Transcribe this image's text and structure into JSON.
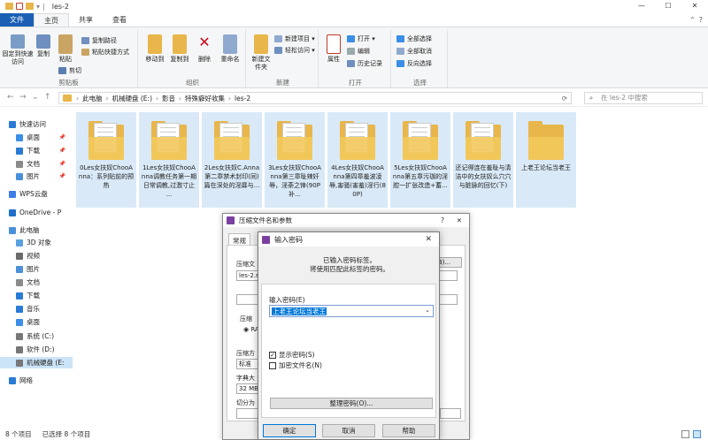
{
  "window": {
    "title": "les-2",
    "controls": [
      "—",
      "☐",
      "✕"
    ]
  },
  "ribbon_tabs": [
    "文件",
    "主页",
    "共享",
    "查看"
  ],
  "ribbon_right": [
    "⌃",
    "?"
  ],
  "ribbon": {
    "clipboard": {
      "pin_label": "固定到快速访问",
      "copy_label": "复制",
      "paste_label": "粘贴",
      "copy_path": "复制路径",
      "paste_shortcut": "粘贴快捷方式",
      "cut": "剪切",
      "group_label": "剪贴板"
    },
    "organize": {
      "move_to": "移动到",
      "copy_to": "复制到",
      "delete": "删除",
      "rename": "重命名",
      "group_label": "组织"
    },
    "new": {
      "new_folder": "新建文件夹",
      "new_item": "新建项目 ▾",
      "easy_access": "轻松访问 ▾",
      "group_label": "新建"
    },
    "open": {
      "properties": "属性",
      "open": "打开 ▾",
      "edit": "编辑",
      "history": "历史记录",
      "group_label": "打开"
    },
    "select": {
      "select_all": "全部选择",
      "select_none": "全部取消",
      "invert": "反向选择",
      "group_label": "选择"
    }
  },
  "address": {
    "path": [
      "此电脑",
      "机械硬盘 (E:)",
      "影音",
      "特殊癖好收集",
      "les-2"
    ],
    "search_placeholder": "在 les-2 中搜索"
  },
  "sidebar": {
    "items": [
      {
        "label": "快速访问",
        "color": "#2a7bd5"
      },
      {
        "label": "桌面",
        "color": "#3a8ee6"
      },
      {
        "label": "下载",
        "color": "#2a7bd5"
      },
      {
        "label": "文档",
        "color": "#8a8a8a"
      },
      {
        "label": "图片",
        "color": "#4a90d9"
      },
      {
        "label": "WPS云盘",
        "color": "#3c7de6"
      },
      {
        "label": "OneDrive - P",
        "color": "#1e6fc8"
      },
      {
        "label": "此电脑",
        "color": "#4a90d9"
      },
      {
        "label": "3D 对象",
        "color": "#5aa0e0"
      },
      {
        "label": "视频",
        "color": "#6a6a6a"
      },
      {
        "label": "图片",
        "color": "#4a90d9"
      },
      {
        "label": "文档",
        "color": "#8a8a8a"
      },
      {
        "label": "下载",
        "color": "#2a7bd5"
      },
      {
        "label": "音乐",
        "color": "#2a7bd5"
      },
      {
        "label": "桌面",
        "color": "#3a8ee6"
      },
      {
        "label": "系统 (C:)",
        "color": "#777777"
      },
      {
        "label": "软件 (D:)",
        "color": "#777777"
      },
      {
        "label": "机械硬盘 (E:",
        "color": "#777777"
      },
      {
        "label": "网络",
        "color": "#2a7bd5"
      }
    ],
    "pin": "📌"
  },
  "files": [
    "0Les女扶奴ChooAnna：系列贴前的预热",
    "1Les女扶奴ChooAnna调教任务第一期 日常调教,过激寸止 ...",
    "2Les女扶奴C.Anna第二章禁术封印(同)篇在深处的淫靡与...",
    "3Les女扶奴ChooAnna第三章耻辣奸辱，淫荼之锋(90P 补...",
    "4Les女扶奴ChooAnna第四章羞波凌辱,害骚(害羞)淫行(80P)",
    "5Les女扶奴ChooAnna第五章污珈的淫腔一扩张改造+蓄...",
    "还记得连在羞耻与清洁中的女扶奴么穴穴与脏脉的回忆(下)",
    "上老王论坛当老王"
  ],
  "status": {
    "count": "8 个项目",
    "selected": "已选择 8 个项目"
  },
  "compress_dialog": {
    "title": "压缩文件名和参数",
    "help": "?",
    "close": "✕",
    "tab": "常规",
    "labels": {
      "archive_name": "压缩文",
      "profile": "配置",
      "format": "压缩",
      "method": "压缩方",
      "dict": "字典大",
      "split": "切分为"
    },
    "values": {
      "archive_name": "les-2.r",
      "method": "标准",
      "dict": "32 MB",
      "browse": "B)...",
      "format_radio": "RA"
    }
  },
  "password_dialog": {
    "title": "输入密码",
    "close": "✕",
    "info_line1": "已输入密码标签。",
    "info_line2": "将使用匹配此标签的密码。",
    "input_label": "输入密码(E)",
    "input_value": "上老王论坛当老王",
    "show_password": "显示密码(S)",
    "encrypt_names": "加密文件名(N)",
    "organize": "整理密码(O)...",
    "ok": "确定",
    "cancel": "取消",
    "help": "帮助"
  }
}
